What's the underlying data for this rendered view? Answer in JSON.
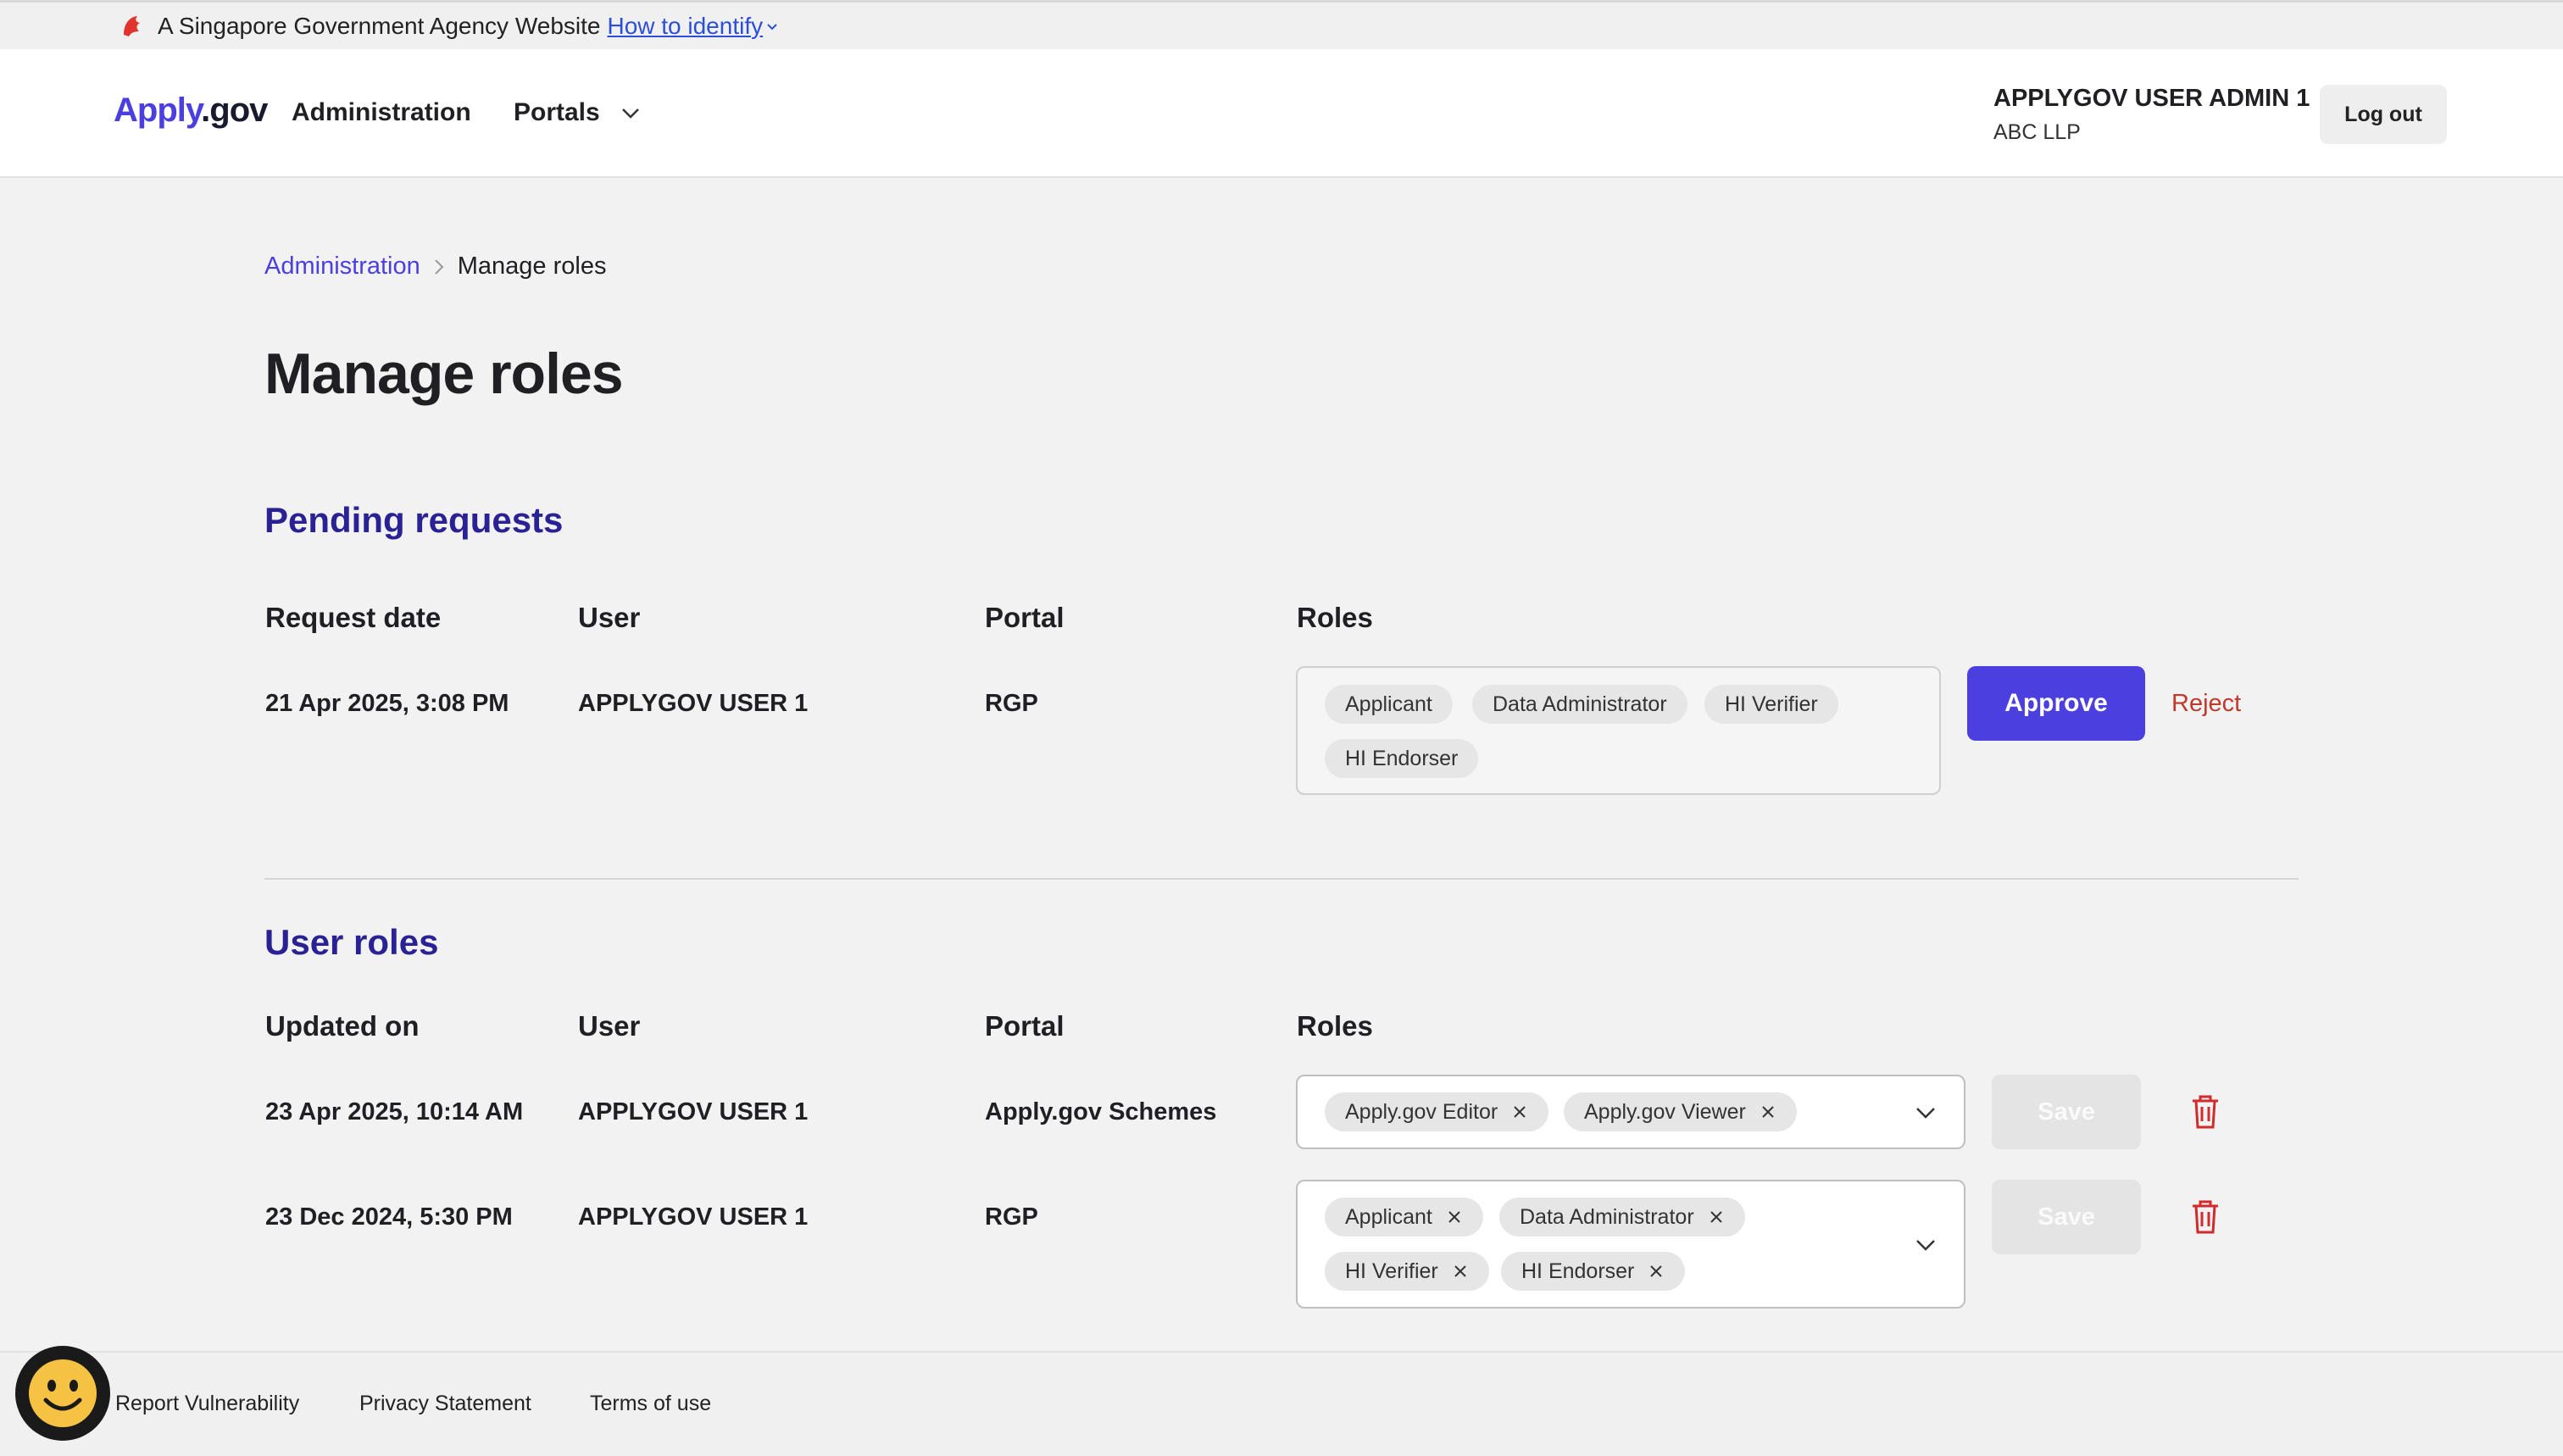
{
  "masthead": {
    "text": "A Singapore Government Agency Website",
    "link": "How to identify"
  },
  "header": {
    "logo_part1": "Apply",
    "logo_part2": ".gov",
    "nav_admin": "Administration",
    "nav_portals": "Portals",
    "user_name": "APPLYGOV USER ADMIN 1",
    "user_org": "ABC LLP",
    "logout_label": "Log out"
  },
  "breadcrumb": {
    "parent": "Administration",
    "current": "Manage roles"
  },
  "page_title": "Manage roles",
  "pending": {
    "title": "Pending requests",
    "columns": [
      "Request date",
      "User",
      "Portal",
      "Roles"
    ],
    "rows": [
      {
        "date": "21 Apr 2025, 3:08 PM",
        "user": "APPLYGOV USER 1",
        "portal": "RGP",
        "roles": [
          "Applicant",
          "Data Administrator",
          "HI Verifier",
          "HI Endorser"
        ]
      }
    ],
    "approve_label": "Approve",
    "reject_label": "Reject"
  },
  "user_roles": {
    "title": "User roles",
    "columns": [
      "Updated on",
      "User",
      "Portal",
      "Roles"
    ],
    "rows": [
      {
        "date": "23 Apr 2025, 10:14 AM",
        "user": "APPLYGOV USER 1",
        "portal": "Apply.gov Schemes",
        "roles": [
          "Apply.gov Editor",
          "Apply.gov Viewer"
        ]
      },
      {
        "date": "23 Dec 2024, 5:30 PM",
        "user": "APPLYGOV USER 1",
        "portal": "RGP",
        "roles": [
          "Applicant",
          "Data Administrator",
          "HI Verifier",
          "HI Endorser"
        ]
      }
    ],
    "save_label": "Save"
  },
  "footer": {
    "links": [
      "Report Vulnerability",
      "Privacy Statement",
      "Terms of use"
    ]
  },
  "colors": {
    "accent": "#4b3fe0",
    "section_heading": "#2a2294",
    "danger": "#c0392b"
  },
  "icons": {
    "masthead": "lion-head-icon",
    "feedback": "smiley-face-icon",
    "delete": "trash-icon",
    "remove_chip": "close-icon",
    "dropdown": "chevron-down-icon"
  }
}
